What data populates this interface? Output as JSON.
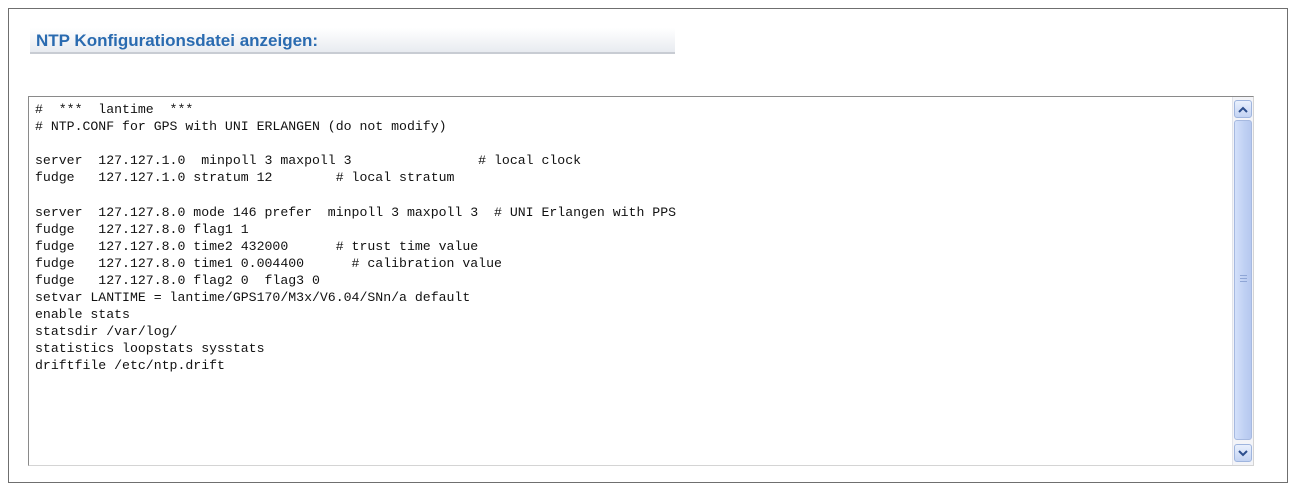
{
  "section": {
    "title": "NTP Konfigurationsdatei anzeigen:"
  },
  "config_file": {
    "lines": [
      "#  ***  lantime  ***",
      "# NTP.CONF for GPS with UNI ERLANGEN (do not modify)",
      "",
      "server  127.127.1.0  minpoll 3 maxpoll 3                # local clock",
      "fudge   127.127.1.0 stratum 12        # local stratum",
      "",
      "server  127.127.8.0 mode 146 prefer  minpoll 3 maxpoll 3  # UNI Erlangen with PPS",
      "fudge   127.127.8.0 flag1 1",
      "fudge   127.127.8.0 time2 432000      # trust time value",
      "fudge   127.127.8.0 time1 0.004400      # calibration value",
      "fudge   127.127.8.0 flag2 0  flag3 0",
      "setvar LANTIME = lantime/GPS170/M3x/V6.04/SNn/a default",
      "enable stats",
      "statsdir /var/log/",
      "statistics loopstats sysstats",
      "driftfile /etc/ntp.drift"
    ]
  },
  "scrollbar": {
    "up_icon": "arrow-up-icon",
    "down_icon": "arrow-down-icon",
    "position_fraction": 0
  }
}
